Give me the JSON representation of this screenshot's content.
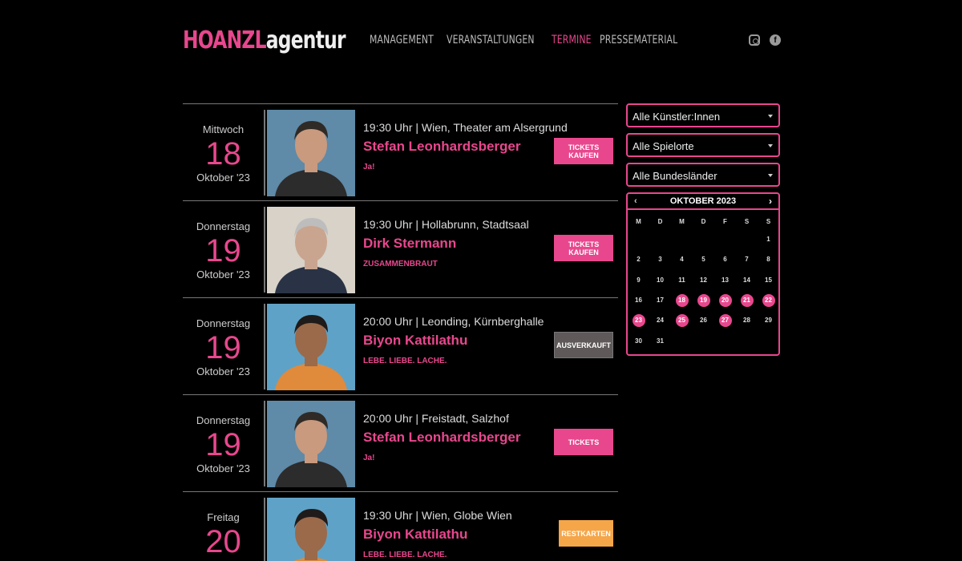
{
  "header": {
    "logo_part1": "HOANZL",
    "logo_part2": "agentur",
    "nav": [
      "MANAGEMENT",
      "VERANSTALTUNGEN",
      "TERMINE",
      "PRESSEMATERIAL"
    ],
    "active_nav": "TERMINE",
    "social": [
      "instagram-icon",
      "facebook-icon"
    ]
  },
  "colors": {
    "accent": "#e8478d",
    "sold_out": "#5f5959",
    "restkarten": "#f5a649",
    "background": "#000000"
  },
  "events": [
    {
      "weekday": "Mittwoch",
      "day": "18",
      "month": "Oktober '23",
      "when": "19:30 Uhr | Wien, Theater am Alsergrund",
      "artist": "Stefan Leonhardsberger",
      "show": "Ja!",
      "button": "TICKETS KAUFEN",
      "button_type": "tickets"
    },
    {
      "weekday": "Donnerstag",
      "day": "19",
      "month": "Oktober '23",
      "when": "19:30 Uhr | Hollabrunn, Stadtsaal",
      "artist": "Dirk Stermann",
      "show": "ZUSAMMENBRAUT",
      "button": "TICKETS KAUFEN",
      "button_type": "tickets"
    },
    {
      "weekday": "Donnerstag",
      "day": "19",
      "month": "Oktober '23",
      "when": "20:00 Uhr | Leonding, Kürnberghalle",
      "artist": "Biyon Kattilathu",
      "show": "LEBE. LIEBE. LACHE.",
      "button": "AUSVERKAUFT",
      "button_type": "sold"
    },
    {
      "weekday": "Donnerstag",
      "day": "19",
      "month": "Oktober '23",
      "when": "20:00 Uhr | Freistadt, Salzhof",
      "artist": "Stefan Leonhardsberger",
      "show": "Ja!",
      "button": "TICKETS",
      "button_type": "tickets"
    },
    {
      "weekday": "Freitag",
      "day": "20",
      "month": "",
      "when": "19:30 Uhr | Wien, Globe Wien",
      "artist": "Biyon Kattilathu",
      "show": "LEBE. LIEBE. LACHE.",
      "button": "RESTKARTEN",
      "button_type": "rest"
    }
  ],
  "filters": {
    "artists": "Alle Künstler:Innen",
    "venues": "Alle Spielorte",
    "states": "Alle Bundesländer"
  },
  "calendar": {
    "title": "OKTOBER 2023",
    "prev": "‹",
    "next": "›",
    "weekdays": [
      "M",
      "D",
      "M",
      "D",
      "F",
      "S",
      "S"
    ],
    "leading_blanks": 6,
    "days": [
      "1",
      "2",
      "3",
      "4",
      "5",
      "6",
      "7",
      "8",
      "9",
      "10",
      "11",
      "12",
      "13",
      "14",
      "15",
      "16",
      "17",
      "18",
      "19",
      "20",
      "21",
      "22",
      "23",
      "24",
      "25",
      "26",
      "27",
      "28",
      "29",
      "30",
      "31"
    ],
    "event_days": [
      "18",
      "19",
      "20",
      "21",
      "22",
      "23",
      "25",
      "27"
    ]
  }
}
